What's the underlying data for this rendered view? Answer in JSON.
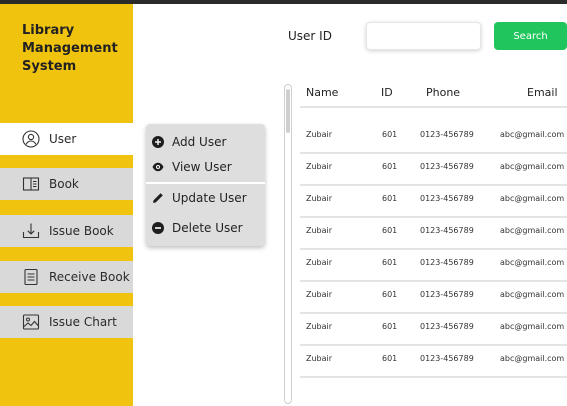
{
  "app": {
    "title_lines": [
      "Library",
      "Management",
      "System"
    ]
  },
  "sidebar": {
    "items": [
      {
        "label": "User",
        "icon": "user-icon"
      },
      {
        "label": "Book",
        "icon": "book-icon"
      },
      {
        "label": "Issue Book",
        "icon": "download-icon"
      },
      {
        "label": "Receive Book",
        "icon": "clipboard-icon"
      },
      {
        "label": "Issue Chart",
        "icon": "image-icon"
      }
    ]
  },
  "user_menu": {
    "items": [
      {
        "label": "Add User",
        "icon": "plus-circle-icon"
      },
      {
        "label": "View User",
        "icon": "eye-icon"
      },
      {
        "label": "Update User",
        "icon": "pencil-icon"
      },
      {
        "label": "Delete User",
        "icon": "minus-circle-icon"
      }
    ]
  },
  "search": {
    "label": "User ID",
    "value": "",
    "placeholder": "",
    "button": "Search"
  },
  "table": {
    "columns": [
      "Name",
      "ID",
      "Phone",
      "Email"
    ],
    "rows": [
      [
        "Zubair",
        "601",
        "0123-456789",
        "abc@gmail.com"
      ],
      [
        "Zubair",
        "601",
        "0123-456789",
        "abc@gmail.com"
      ],
      [
        "Zubair",
        "601",
        "0123-456789",
        "abc@gmail.com"
      ],
      [
        "Zubair",
        "601",
        "0123-456789",
        "abc@gmail.com"
      ],
      [
        "Zubair",
        "601",
        "0123-456789",
        "abc@gmail.com"
      ],
      [
        "Zubair",
        "601",
        "0123-456789",
        "abc@gmail.com"
      ],
      [
        "Zubair",
        "601",
        "0123-456789",
        "abc@gmail.com"
      ],
      [
        "Zubair",
        "601",
        "0123-456789",
        "abc@gmail.com"
      ]
    ]
  },
  "colors": {
    "sidebar": "#f0c30f",
    "search_button": "#21c55d",
    "menu": "#dedede"
  }
}
